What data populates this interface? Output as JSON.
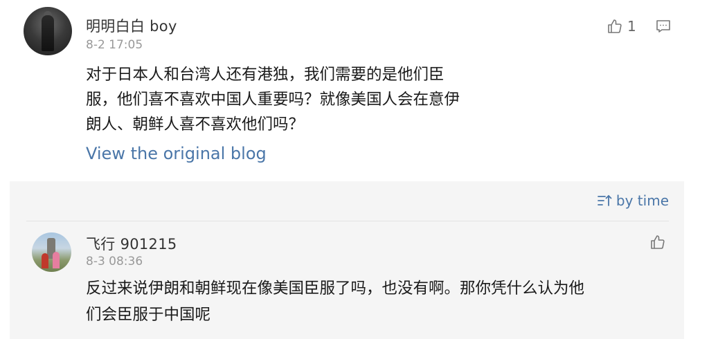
{
  "post": {
    "username": "明明白白 boy",
    "timestamp": "8-2 17:05",
    "text_lines": [
      "对于日本人和台湾人还有港独，我们需要的是他们臣",
      "服，他们喜不喜欢中国人重要吗？就像美国人会在意伊",
      "朗人、朝鲜人喜不喜欢他们吗？"
    ],
    "like_count": "1",
    "view_original_label": "View the original blog"
  },
  "comments": {
    "sort_label": "by time",
    "reply": {
      "username": "飞行 901215",
      "timestamp": "8-3 08:36",
      "text_lines": [
        "反过来说伊朗和朝鲜现在像美国臣服了吗，也没有啊。那你凭什么认为他",
        "们会臣服于中国呢"
      ]
    }
  },
  "colors": {
    "link": "#4a76a8",
    "comments_bg": "#f5f5f5",
    "muted": "#999999"
  }
}
